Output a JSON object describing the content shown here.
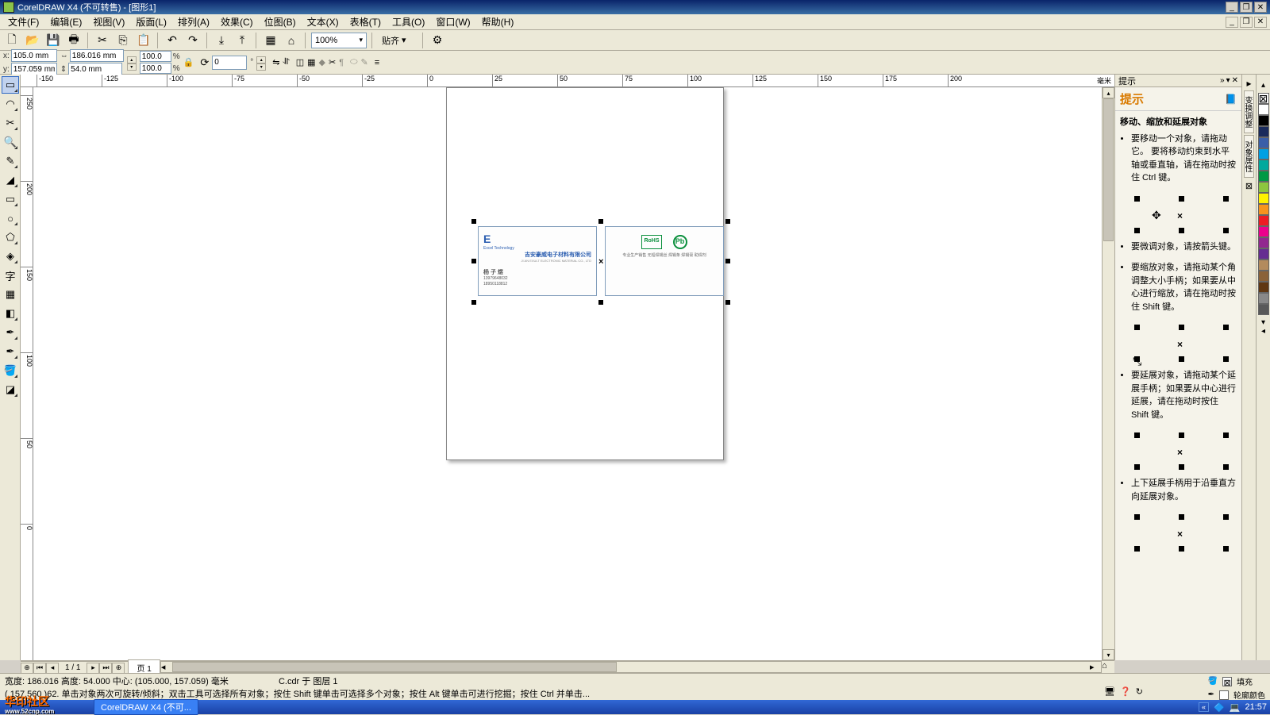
{
  "title": "CorelDRAW X4 (不可转售) - [图形1]",
  "menu": [
    "文件(F)",
    "编辑(E)",
    "视图(V)",
    "版面(L)",
    "排列(A)",
    "效果(C)",
    "位图(B)",
    "文本(X)",
    "表格(T)",
    "工具(O)",
    "窗口(W)",
    "帮助(H)"
  ],
  "toolbar1": {
    "zoom": "100%",
    "snap": "贴齐"
  },
  "propbar": {
    "x_label": "x:",
    "y_label": "y:",
    "x": "105.0 mm",
    "y": "157.059 mm",
    "w_label": "↔",
    "h_label": "↕",
    "w": "186.016 mm",
    "h": "54.0 mm",
    "scale_x": "100.0",
    "scale_y": "100.0",
    "pct": "%",
    "rotate": "0",
    "deg": "°"
  },
  "ruler_h": [
    -25,
    0,
    25,
    50,
    75,
    100,
    125,
    150,
    175,
    200
  ],
  "ruler_h_pos": [
    30,
    195,
    360,
    526,
    692,
    858,
    1024,
    1189
  ],
  "ruler_h_units": "毫米",
  "ruler_v": [
    250,
    200,
    150,
    100,
    50
  ],
  "page_nav": {
    "indicator": "1 / 1",
    "tab": "页 1"
  },
  "status": {
    "line1": "宽度: 186.016  高度: 54.000  中心: (105.000, 157.059)  毫米",
    "line1b": "C.cdr 于 图层 1",
    "line2": "( 157.560 )62.  单击对象两次可旋转/倾斜；双击工具可选择所有对象；按住 Shift 键单击可选择多个对象；按住 Alt 键单击可进行挖掘；按住 Ctrl 并单击...",
    "fill": "填充",
    "outline": "轮廓颜色"
  },
  "hints": {
    "docker": "提示",
    "title": "提示",
    "heading": "移动、缩放和延展对象",
    "items": [
      "要移动一个对象，请拖动它。  要将移动约束到水平轴或垂直轴，请在拖动时按住 Ctrl 键。",
      "要微调对象，请按箭头键。",
      "要缩放对象，请拖动某个角调整大小手柄；如果要从中心进行缩放，请在拖动时按住 Shift 键。",
      "要延展对象，请拖动某个延展手柄；如果要从中心进行延展，请在拖动时按住 Shift 键。",
      "上下延展手柄用于沿垂直方向延展对象。"
    ]
  },
  "side_tabs": [
    "变换调整",
    "对象属性"
  ],
  "colors": {
    "swatches": [
      "#ffffff",
      "#000000",
      "#1a2b5c",
      "#3a5fa8",
      "#00a0e3",
      "#00a99d",
      "#009944",
      "#8cc63e",
      "#fff200",
      "#f7941d",
      "#ed1c24",
      "#ec008c",
      "#92278f",
      "#662d91",
      "#b38b5d",
      "#8a6239",
      "#603813",
      "#898989",
      "#595959"
    ]
  },
  "taskbar": {
    "app": "CorelDRAW X4 (不可...",
    "time": "21:57",
    "watermark": "华印社区",
    "url": "www.52cnp.com"
  },
  "cards": {
    "c1_logo": "E",
    "c1_sub": "Excel Technology",
    "c1_title": "吉安豪威电子材料有限公司",
    "c1_sub2": "JI AN EXULT ELECTRONIC MATERIAL CO., LTD",
    "c1_name": "杨 子 煜",
    "c1_phone1": "13979648032",
    "c1_phone2": "18950118812",
    "c2_badge1": "RoHS",
    "c2_badge2": "Pb",
    "c2_text": "专业生产销售 无铅焊锡丝 焊锡条 焊锡膏 助焊剂"
  }
}
